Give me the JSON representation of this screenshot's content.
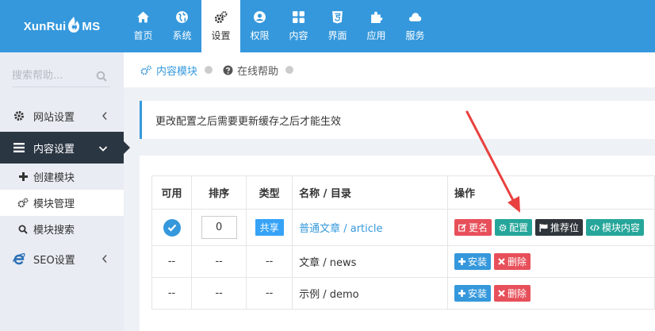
{
  "logo": {
    "text_before": "XunRui",
    "text_after": "MS"
  },
  "nav": [
    {
      "label": "首页",
      "icon": "home-icon"
    },
    {
      "label": "系统",
      "icon": "globe-icon"
    },
    {
      "label": "设置",
      "icon": "cogs-icon",
      "active": true
    },
    {
      "label": "权限",
      "icon": "user-icon"
    },
    {
      "label": "内容",
      "icon": "grid-icon"
    },
    {
      "label": "界面",
      "icon": "html5-icon"
    },
    {
      "label": "应用",
      "icon": "puzzle-icon"
    },
    {
      "label": "服务",
      "icon": "cloud-icon"
    }
  ],
  "sidebar": {
    "search_placeholder": "搜索帮助...",
    "items": [
      {
        "label": "网站设置",
        "icon": "gear-icon"
      },
      {
        "label": "内容设置",
        "icon": "list-icon",
        "active": true
      },
      {
        "label": "SEO设置",
        "icon": "ie-icon"
      }
    ],
    "subitems": [
      {
        "label": "创建模块",
        "icon": "plus-icon"
      },
      {
        "label": "模块管理",
        "icon": "cogs-icon",
        "current": true
      },
      {
        "label": "模块搜索",
        "icon": "search-icon"
      }
    ]
  },
  "breadcrumb": {
    "first": "内容模块",
    "second": "在线帮助"
  },
  "notice": "更改配置之后需要更新缓存之后才能生效",
  "table": {
    "headers": {
      "available": "可用",
      "sort": "排序",
      "type": "类型",
      "name": "名称 / 目录",
      "ops": "操作"
    },
    "rows": [
      {
        "available": "",
        "sort": "0",
        "type": "共享",
        "name": "普通文章 / article",
        "ops": [
          "更名",
          "配置",
          "推荐位",
          "模块内容"
        ]
      },
      {
        "available": "--",
        "sort": "--",
        "type": "--",
        "name": "文章 / news",
        "ops": [
          "安装",
          "删除"
        ]
      },
      {
        "available": "--",
        "sort": "--",
        "type": "--",
        "name": "示例 / demo",
        "ops": [
          "安装",
          "删除"
        ]
      }
    ]
  },
  "colors": {
    "primary": "#3598dc",
    "sidebar_dark": "#2b3643",
    "red": "#e7505a",
    "green": "#26a69a",
    "arrow": "#e8413f"
  }
}
